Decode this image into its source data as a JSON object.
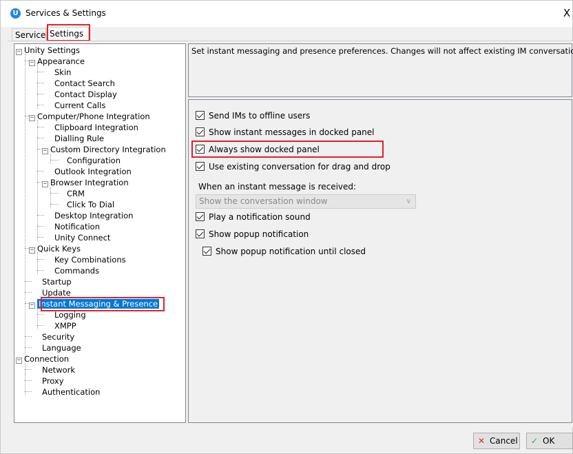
{
  "window": {
    "title": "Services & Settings",
    "close_glyph": "X",
    "app_icon_letter": "U"
  },
  "tabs": [
    {
      "label": "Services",
      "active": false
    },
    {
      "label": "Settings",
      "active": true
    }
  ],
  "tree": {
    "items": [
      {
        "label": "Unity Settings",
        "expander": "−"
      },
      {
        "label": "Appearance",
        "expander": "−"
      },
      {
        "label": "Skin"
      },
      {
        "label": "Contact Search"
      },
      {
        "label": "Contact Display"
      },
      {
        "label": "Current Calls"
      },
      {
        "label": "Computer/Phone Integration",
        "expander": "−"
      },
      {
        "label": "Clipboard Integration"
      },
      {
        "label": "Dialling Rule"
      },
      {
        "label": "Custom Directory Integration",
        "expander": "−"
      },
      {
        "label": "Configuration"
      },
      {
        "label": "Outlook Integration"
      },
      {
        "label": "Browser Integration",
        "expander": "−"
      },
      {
        "label": "CRM"
      },
      {
        "label": "Click To Dial"
      },
      {
        "label": "Desktop Integration"
      },
      {
        "label": "Notification"
      },
      {
        "label": "Unity Connect"
      },
      {
        "label": "Quick Keys",
        "expander": "−"
      },
      {
        "label": "Key Combinations"
      },
      {
        "label": "Commands"
      },
      {
        "label": "Startup"
      },
      {
        "label": "Update"
      },
      {
        "label": "Instant Messaging & Presence",
        "expander": "−",
        "selected": true
      },
      {
        "label": "Logging"
      },
      {
        "label": "XMPP"
      },
      {
        "label": "Security"
      },
      {
        "label": "Language"
      },
      {
        "label": "Connection",
        "expander": "−"
      },
      {
        "label": "Network"
      },
      {
        "label": "Proxy"
      },
      {
        "label": "Authentication"
      }
    ]
  },
  "description": "Set instant messaging and presence preferences.  Changes will not affect existing IM conversations.",
  "settings": {
    "send_offline": {
      "label": "Send IMs to offline users",
      "checked": true
    },
    "show_docked": {
      "label": "Show instant messages in docked panel",
      "checked": true
    },
    "always_docked": {
      "label": "Always show docked panel",
      "checked": true
    },
    "use_existing": {
      "label": "Use existing conversation for drag and drop",
      "checked": true
    },
    "received_label": "When an instant message is received:",
    "received_value": "Show the conversation window",
    "combo_arrow": "∨",
    "play_sound": {
      "label": "Play a notification sound",
      "checked": true
    },
    "show_popup": {
      "label": "Show popup notification",
      "checked": true
    },
    "popup_until_closed": {
      "label": "Show popup notification until closed",
      "checked": true
    }
  },
  "buttons": {
    "cancel": {
      "label": "Cancel",
      "icon": "x-icon",
      "glyph": "✕"
    },
    "ok": {
      "label": "OK",
      "icon": "check-icon",
      "glyph": "✓"
    }
  },
  "colors": {
    "highlight": "#e0202a",
    "selection": "#0078d7"
  }
}
